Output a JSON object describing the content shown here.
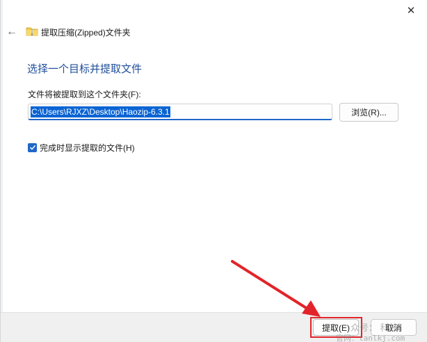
{
  "window": {
    "close_glyph": "✕"
  },
  "nav": {
    "back_glyph": "←",
    "title": "提取压缩(Zipped)文件夹",
    "folder_icon": "zip-folder-icon"
  },
  "main": {
    "heading": "选择一个目标并提取文件",
    "path_label": "文件将被提取到这个文件夹(F):",
    "path_value": "C:\\Users\\RJXZ\\Desktop\\Haozip-6.3.1",
    "browse_label": "浏览(R)...",
    "show_files_label": "完成时显示提取的文件(H)",
    "show_files_checked": true
  },
  "footer": {
    "extract_label": "提取(E)",
    "cancel_label": "取消"
  },
  "watermark": {
    "line1": "众号：  科技",
    "line2": "官网：tanlkj.com"
  },
  "colors": {
    "accent": "#1f67c9",
    "heading": "#1f4e9a",
    "annotation_red": "#e2242a"
  }
}
